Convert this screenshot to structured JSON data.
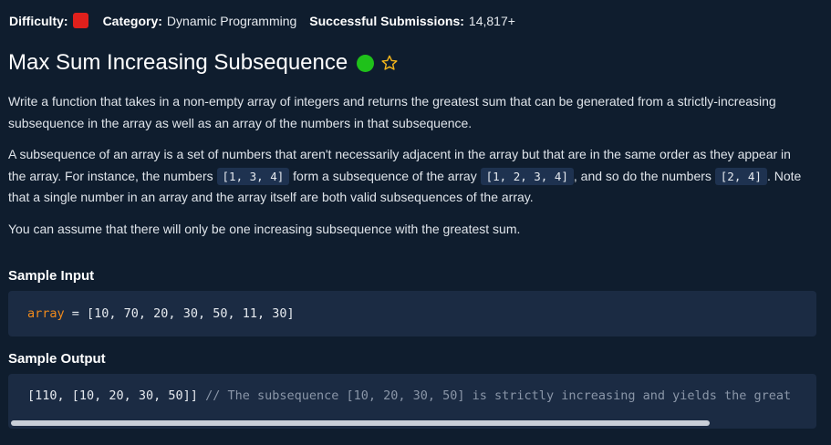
{
  "meta": {
    "difficulty_label": "Difficulty:",
    "difficulty_color": "#e0201c",
    "category_label": "Category:",
    "category_value": "Dynamic Programming",
    "submissions_label": "Successful Submissions:",
    "submissions_value": "14,817+"
  },
  "title": "Max Sum Increasing Subsequence",
  "status_icon": "completed-dot",
  "favorite_icon": "star-outline",
  "description": {
    "p1": "Write a function that takes in a non-empty array of integers and returns the greatest sum that can be generated from a strictly-increasing subsequence in the array as well as an array of the numbers in that subsequence.",
    "p2_a": "A subsequence of an array is a set of numbers that aren't necessarily adjacent in the array but that are in the same order as they appear in the array. For instance, the numbers ",
    "p2_code1": "[1, 3, 4]",
    "p2_b": " form a subsequence of the array ",
    "p2_code2": "[1, 2, 3, 4]",
    "p2_c": ", and so do the numbers ",
    "p2_code3": "[2, 4]",
    "p2_d": ". Note that a single number in an array and the array itself are both valid subsequences of the array.",
    "p3": "You can assume that there will only be one increasing subsequence with the greatest sum."
  },
  "sample_input": {
    "label": "Sample Input",
    "var": "array",
    "eq": " = ",
    "value": "[10, 70, 20, 30, 50, 11, 30]"
  },
  "sample_output": {
    "label": "Sample Output",
    "value": "[110, [10, 20, 30, 50]]",
    "comment": " // The subsequence [10, 20, 30, 50] is strictly increasing and yields the great"
  }
}
